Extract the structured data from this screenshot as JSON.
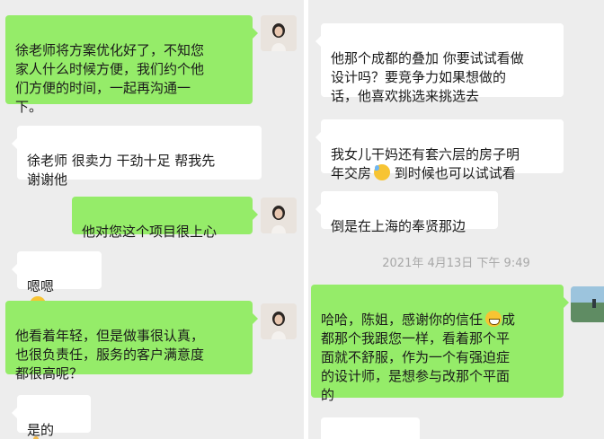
{
  "left_panel": {
    "messages": [
      {
        "side": "me",
        "text": "徐老师将方案优化好了，不知您\n家人什么时候方便，我们约个他\n们方便的时间，一起再沟通一\n下。"
      },
      {
        "side": "other",
        "text": "徐老师 很卖力  干劲十足  帮我先\n谢谢他"
      },
      {
        "side": "me",
        "text": "他对您这个项目很上心"
      },
      {
        "side": "other",
        "text": "嗯嗯",
        "emoji": "face-emoji"
      },
      {
        "side": "me",
        "text": "他看着年轻，但是做事很认真，\n也很负责任，服务的客户满意度\n都很高呢？"
      },
      {
        "side": "other",
        "text": "是的",
        "emoji": "thumbs-up-emoji"
      }
    ]
  },
  "right_panel": {
    "messages": [
      {
        "side": "other",
        "text": "他那个成都的叠加 你要试试看做\n设计吗？要竞争力如果想做的\n话，他喜欢挑选来挑选去"
      },
      {
        "side": "other",
        "text_before": "我女儿干妈还有套六层的房子明\n年交房",
        "emoji": "sweat-smile-emoji",
        "text_after": " 到时候也可以试试看"
      },
      {
        "side": "other",
        "text": "倒是在上海的奉贤那边"
      },
      {
        "side": "me",
        "text_before": "哈哈，陈姐，感谢你的信任",
        "emoji": "grin-emoji",
        "text_after": "成\n都那个我跟您一样，看着那个平\n面就不舒服，作为一个有强迫症\n的设计师，是想参与改那个平面\n的"
      }
    ],
    "timestamp": "2021年 4月13日  下午 9:49"
  }
}
